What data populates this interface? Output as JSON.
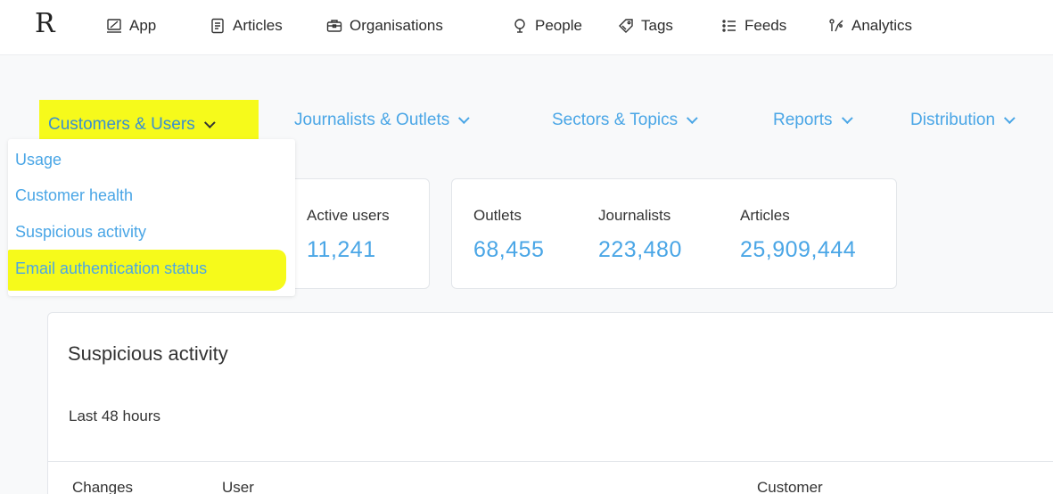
{
  "brand": {
    "logo": "R"
  },
  "topnav": [
    {
      "label": "App",
      "icon": "laptop-icon"
    },
    {
      "label": "Articles",
      "icon": "document-icon"
    },
    {
      "label": "Organisations",
      "icon": "briefcase-icon"
    },
    {
      "label": "People",
      "icon": "person-icon"
    },
    {
      "label": "Tags",
      "icon": "tag-icon"
    },
    {
      "label": "Feeds",
      "icon": "list-icon"
    },
    {
      "label": "Analytics",
      "icon": "analytics-icon"
    }
  ],
  "subnav": [
    {
      "label": "Customers & Users",
      "highlighted": true
    },
    {
      "label": "Journalists & Outlets"
    },
    {
      "label": "Sectors & Topics"
    },
    {
      "label": "Reports"
    },
    {
      "label": "Distribution"
    }
  ],
  "dropdown": {
    "items": [
      {
        "label": "Usage"
      },
      {
        "label": "Customer health"
      },
      {
        "label": "Suspicious activity"
      },
      {
        "label": "Email authentication status",
        "highlighted": true
      }
    ]
  },
  "stats": {
    "active_users": {
      "label": "Active users",
      "value": "11,241"
    },
    "outlets": {
      "label": "Outlets",
      "value": "68,455"
    },
    "journalists": {
      "label": "Journalists",
      "value": "223,480"
    },
    "articles": {
      "label": "Articles",
      "value": "25,909,444"
    }
  },
  "panel": {
    "title": "Suspicious activity",
    "subtitle": "Last 48 hours",
    "columns": [
      "Changes",
      "User",
      "Customer"
    ]
  },
  "colors": {
    "accent": "#4aa6e6",
    "highlight": "#f6fa1b"
  }
}
